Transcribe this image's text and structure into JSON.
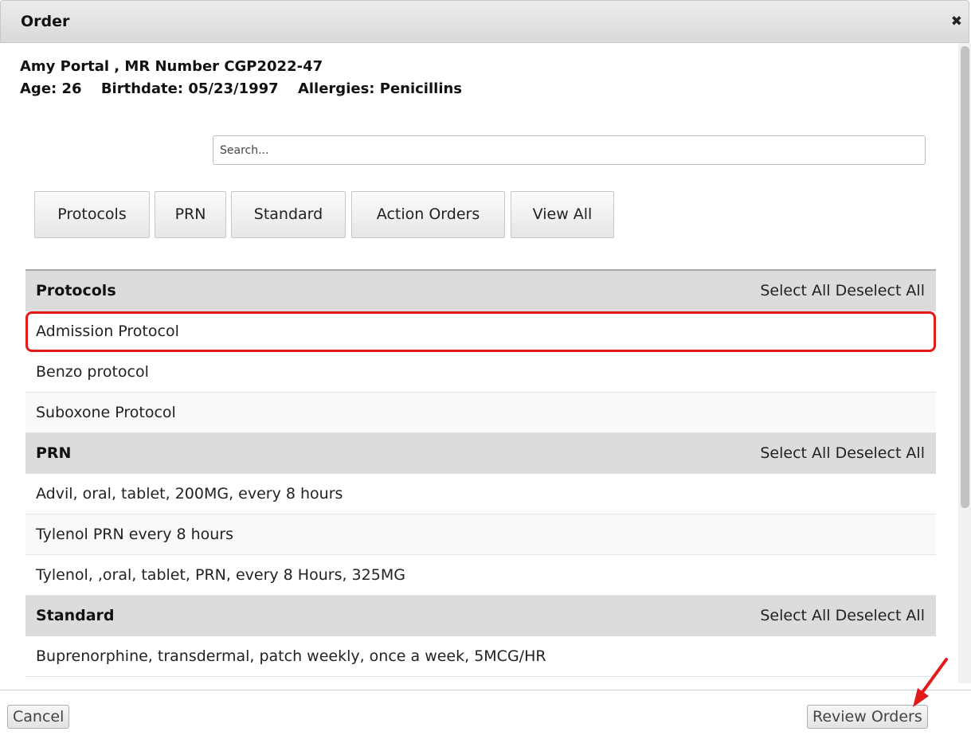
{
  "dialog": {
    "title": "Order",
    "close_glyph": "✖"
  },
  "patient": {
    "name_line": "Amy Portal , MR Number CGP2022-47",
    "age": "Age: 26",
    "birthdate": "Birthdate: 05/23/1997",
    "allergies": "Allergies: Penicillins"
  },
  "search": {
    "placeholder": "Search...",
    "value": ""
  },
  "filters": [
    "Protocols",
    "PRN",
    "Standard",
    "Action Orders",
    "View All"
  ],
  "groups": [
    {
      "name": "Protocols",
      "select_all": "Select All",
      "deselect_all": "Deselect All",
      "items": [
        "Admission Protocol",
        "Benzo protocol",
        "Suboxone Protocol"
      ]
    },
    {
      "name": "PRN",
      "select_all": "Select All",
      "deselect_all": "Deselect All",
      "items": [
        "Advil, oral, tablet, 200MG, every 8 hours",
        "Tylenol PRN every 8 hours",
        "Tylenol, ,oral, tablet, PRN, every 8 Hours, 325MG"
      ]
    },
    {
      "name": "Standard",
      "select_all": "Select All",
      "deselect_all": "Deselect All",
      "items": [
        "Buprenorphine, transdermal, patch weekly, once a week, 5MCG/HR"
      ]
    }
  ],
  "footer": {
    "cancel_label": "Cancel",
    "review_label": "Review Orders"
  },
  "colors": {
    "highlight": "#e21a1a",
    "arrow": "#e21a1a",
    "group_header_bg": "#dcdcdc"
  },
  "icons": {
    "close": "close-icon",
    "annotation_arrow": "arrow-icon"
  }
}
